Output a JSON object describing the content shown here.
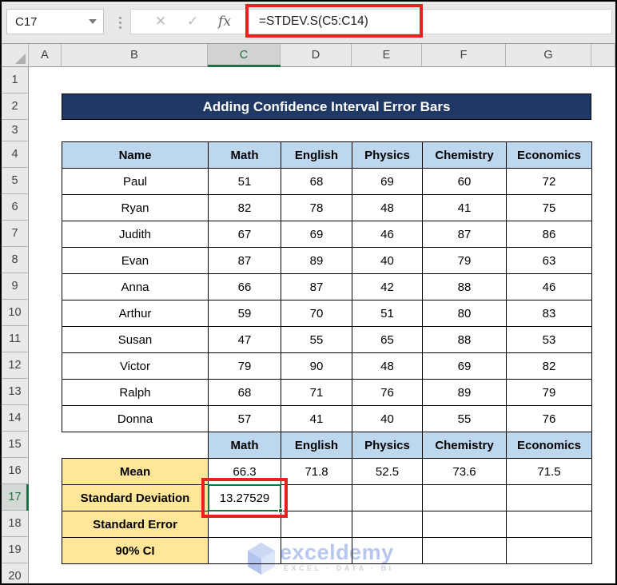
{
  "window": {
    "name_box": "C17",
    "formula": "=STDEV.S(C5:C14)",
    "fx_label": "fx",
    "cancel_icon": "✕",
    "enter_icon": "✓"
  },
  "grid": {
    "column_headers": [
      "A",
      "B",
      "C",
      "D",
      "E",
      "F",
      "G"
    ],
    "selected_column": "C",
    "row_headers": [
      "1",
      "2",
      "3",
      "4",
      "5",
      "6",
      "7",
      "8",
      "9",
      "10",
      "11",
      "12",
      "13",
      "14",
      "15",
      "16",
      "17",
      "18",
      "19",
      "20"
    ],
    "selected_row": "17"
  },
  "content": {
    "title": "Adding Confidence Interval Error Bars",
    "scores_table": {
      "headers": [
        "Name",
        "Math",
        "English",
        "Physics",
        "Chemistry",
        "Economics"
      ],
      "rows": [
        [
          "Paul",
          "51",
          "68",
          "69",
          "60",
          "72"
        ],
        [
          "Ryan",
          "82",
          "78",
          "48",
          "41",
          "75"
        ],
        [
          "Judith",
          "67",
          "69",
          "46",
          "87",
          "86"
        ],
        [
          "Evan",
          "87",
          "89",
          "40",
          "79",
          "63"
        ],
        [
          "Anna",
          "66",
          "87",
          "42",
          "88",
          "46"
        ],
        [
          "Arthur",
          "59",
          "70",
          "51",
          "80",
          "83"
        ],
        [
          "Susan",
          "47",
          "55",
          "65",
          "88",
          "53"
        ],
        [
          "Victor",
          "79",
          "90",
          "48",
          "69",
          "82"
        ],
        [
          "Ralph",
          "68",
          "71",
          "76",
          "89",
          "79"
        ],
        [
          "Donna",
          "57",
          "41",
          "40",
          "55",
          "76"
        ]
      ]
    },
    "stats_table": {
      "headers": [
        "Math",
        "English",
        "Physics",
        "Chemistry",
        "Economics"
      ],
      "rows": [
        {
          "label": "Mean",
          "values": [
            "66.3",
            "71.8",
            "52.5",
            "73.6",
            "71.5"
          ]
        },
        {
          "label": "Standard Deviation",
          "values": [
            "13.27529",
            "",
            "",
            "",
            ""
          ]
        },
        {
          "label": "Standard Error",
          "values": [
            "",
            "",
            "",
            "",
            ""
          ]
        },
        {
          "label": "90% CI",
          "values": [
            "",
            "",
            "",
            "",
            ""
          ]
        }
      ],
      "selected_cell": {
        "ref": "C17",
        "value": "13.27529"
      }
    },
    "watermark": {
      "brand": "exceldemy",
      "tagline": "EXCEL · DATA · BI"
    }
  },
  "colors": {
    "banner_bg": "#203864",
    "header_blue": "#BDD7EE",
    "label_yellow": "#FFE699",
    "selection_green": "#1E7145",
    "annotation_red": "#E2231E"
  }
}
